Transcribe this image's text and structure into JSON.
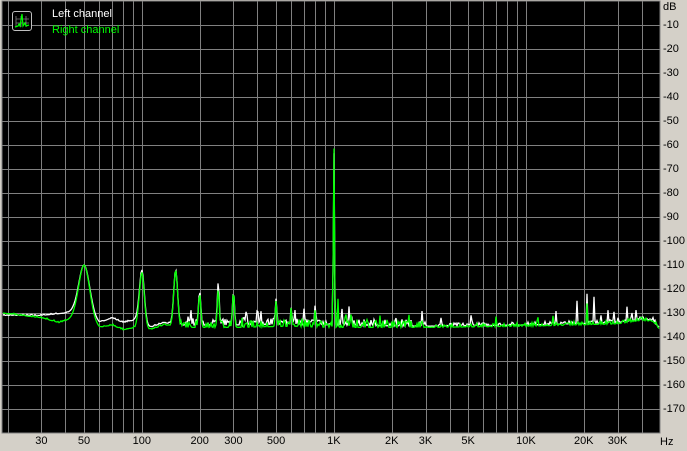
{
  "chart_data": {
    "type": "line",
    "title": "",
    "xlabel": "Hz",
    "ylabel": "dB",
    "xscale": "log",
    "xlim": [
      18.7,
      49900
    ],
    "ylim": [
      -180,
      0
    ],
    "grid": true,
    "legend_position": "top-left",
    "x_ticks": [
      {
        "value": 30,
        "label": "30"
      },
      {
        "value": 50,
        "label": "50"
      },
      {
        "value": 100,
        "label": "100"
      },
      {
        "value": 200,
        "label": "200"
      },
      {
        "value": 300,
        "label": "300"
      },
      {
        "value": 500,
        "label": "500"
      },
      {
        "value": 1000,
        "label": "1K"
      },
      {
        "value": 2000,
        "label": "2K"
      },
      {
        "value": 3000,
        "label": "3K"
      },
      {
        "value": 5000,
        "label": "5K"
      },
      {
        "value": 10000,
        "label": "10K"
      },
      {
        "value": 20000,
        "label": "20K"
      },
      {
        "value": 30000,
        "label": "30K"
      }
    ],
    "x_grid": [
      20,
      30,
      40,
      50,
      60,
      70,
      80,
      90,
      100,
      200,
      300,
      400,
      500,
      600,
      700,
      800,
      900,
      1000,
      2000,
      3000,
      4000,
      5000,
      6000,
      7000,
      8000,
      9000,
      10000,
      20000,
      30000,
      40000
    ],
    "y_ticks": [
      -10,
      -20,
      -30,
      -40,
      -50,
      -60,
      -70,
      -80,
      -90,
      -100,
      -110,
      -120,
      -130,
      -140,
      -150,
      -160,
      -170
    ],
    "y_unit_label": "dB",
    "x_unit_label": "Hz",
    "series": [
      {
        "name": "Left channel",
        "color": "#ffffff",
        "noise_db": 1.6,
        "seed": 7,
        "baseline": [
          [
            18.7,
            -131
          ],
          [
            30,
            -131
          ],
          [
            40,
            -130
          ],
          [
            44,
            -129.5
          ],
          [
            55,
            -132
          ],
          [
            60,
            -134
          ],
          [
            70,
            -132
          ],
          [
            80,
            -134
          ],
          [
            90,
            -133
          ],
          [
            96,
            -131
          ],
          [
            110,
            -136
          ],
          [
            130,
            -134
          ],
          [
            160,
            -135
          ],
          [
            300,
            -135
          ],
          [
            600,
            -134.5
          ],
          [
            1000,
            -135
          ],
          [
            3000,
            -135.5
          ],
          [
            10000,
            -135
          ],
          [
            30000,
            -134
          ],
          [
            40000,
            -132.5
          ],
          [
            46000,
            -133
          ],
          [
            49900,
            -137
          ]
        ],
        "peaks": [
          [
            50,
            -110,
            0.028
          ],
          [
            100,
            -112,
            0.012
          ],
          [
            150,
            -112,
            0.01
          ],
          [
            200,
            -121,
            0.006
          ],
          [
            250,
            -117,
            0.005
          ],
          [
            300,
            -121,
            0.005
          ],
          [
            350,
            -129,
            0.004
          ],
          [
            400,
            -128,
            0.004
          ],
          [
            500,
            -124,
            0.004
          ],
          [
            600,
            -127,
            0.003
          ],
          [
            700,
            -128,
            0.003
          ],
          [
            800,
            -126,
            0.003
          ],
          [
            1000,
            -62,
            0.003
          ],
          [
            1100,
            -128,
            0.003
          ],
          [
            1200,
            -127,
            0.002
          ],
          [
            3600,
            -131,
            0.002
          ],
          [
            5200,
            -128,
            0.002
          ],
          [
            14300,
            -127,
            0.0015
          ],
          [
            18400,
            -122,
            0.0015
          ],
          [
            20800,
            -122,
            0.0015
          ],
          [
            22600,
            -123,
            0.0015
          ],
          [
            24500,
            -128,
            0.0015
          ],
          [
            26800,
            -128,
            0.0015
          ],
          [
            28700,
            -129,
            0.0015
          ],
          [
            30300,
            -129,
            0.0015
          ],
          [
            33500,
            -125,
            0.0015
          ],
          [
            35500,
            -125,
            0.0015
          ],
          [
            37500,
            -128,
            0.0015
          ]
        ]
      },
      {
        "name": "Right channel",
        "color": "#00ff00",
        "noise_db": 1.8,
        "seed": 23,
        "baseline": [
          [
            18.7,
            -130
          ],
          [
            30,
            -132
          ],
          [
            37,
            -134
          ],
          [
            45,
            -132
          ],
          [
            55,
            -134
          ],
          [
            60,
            -136
          ],
          [
            70,
            -135
          ],
          [
            80,
            -137
          ],
          [
            92,
            -136
          ],
          [
            96,
            -133
          ],
          [
            110,
            -137
          ],
          [
            130,
            -135
          ],
          [
            160,
            -136
          ],
          [
            300,
            -136
          ],
          [
            600,
            -135.5
          ],
          [
            1000,
            -136
          ],
          [
            3000,
            -136
          ],
          [
            10000,
            -135.5
          ],
          [
            30000,
            -134.5
          ],
          [
            40000,
            -133
          ],
          [
            46000,
            -133.5
          ],
          [
            49900,
            -137
          ]
        ],
        "peaks": [
          [
            50,
            -110,
            0.028
          ],
          [
            100,
            -113,
            0.012
          ],
          [
            150,
            -112,
            0.01
          ],
          [
            200,
            -122,
            0.006
          ],
          [
            250,
            -120,
            0.005
          ],
          [
            300,
            -121,
            0.005
          ],
          [
            500,
            -125,
            0.004
          ],
          [
            600,
            -127,
            0.003
          ],
          [
            800,
            -128,
            0.003
          ],
          [
            1000,
            -60,
            0.003
          ],
          [
            1050,
            -124,
            0.002
          ],
          [
            1150,
            -125,
            0.002
          ],
          [
            7000,
            -131,
            0.002
          ],
          [
            11500,
            -129,
            0.002
          ],
          [
            13800,
            -130,
            0.0015
          ],
          [
            20800,
            -126,
            0.0015
          ]
        ]
      }
    ]
  }
}
